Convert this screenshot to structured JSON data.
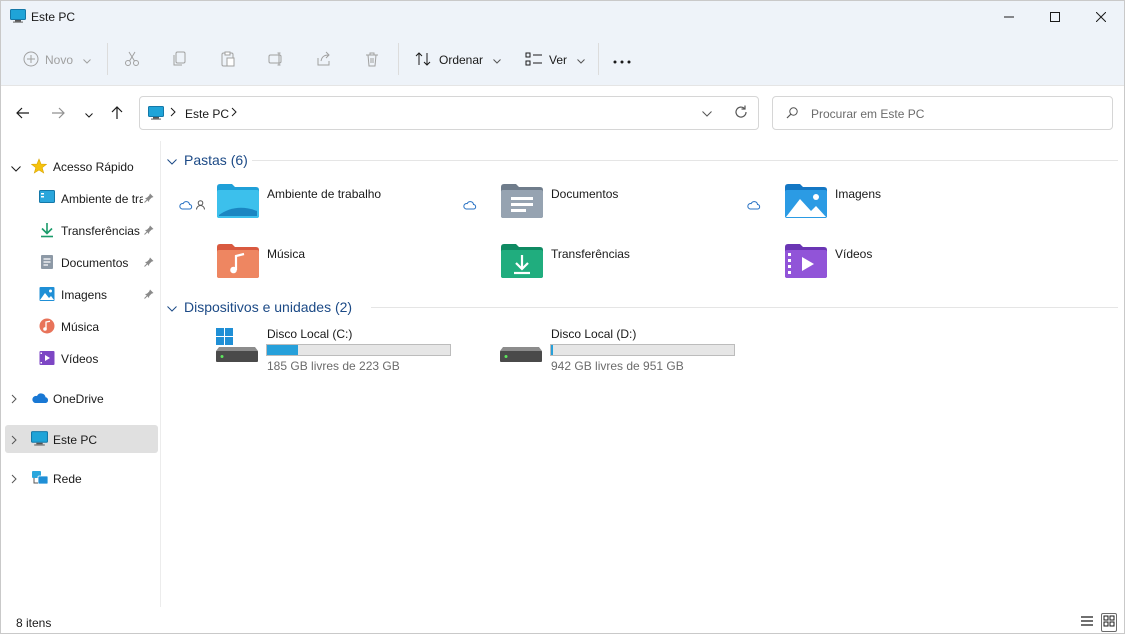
{
  "window": {
    "title": "Este PC"
  },
  "toolbar": {
    "new_label": "Novo",
    "sort_label": "Ordenar",
    "view_label": "Ver"
  },
  "address": {
    "breadcrumb": "Este PC",
    "search_placeholder": "Procurar em Este PC"
  },
  "sidebar": {
    "quick_access": "Acesso Rápido",
    "items": [
      {
        "label": "Ambiente de trabalho",
        "icon": "desktop-icon"
      },
      {
        "label": "Transferências",
        "icon": "downloads-icon"
      },
      {
        "label": "Documentos",
        "icon": "documents-icon"
      },
      {
        "label": "Imagens",
        "icon": "pictures-icon"
      },
      {
        "label": "Música",
        "icon": "music-icon"
      },
      {
        "label": "Vídeos",
        "icon": "videos-icon"
      }
    ],
    "onedrive": "OneDrive",
    "this_pc": "Este PC",
    "network": "Rede"
  },
  "folders": {
    "header": "Pastas (6)",
    "items": [
      {
        "name": "Ambiente de trabalho"
      },
      {
        "name": "Documentos"
      },
      {
        "name": "Imagens"
      },
      {
        "name": "Música"
      },
      {
        "name": "Transferências"
      },
      {
        "name": "Vídeos"
      }
    ]
  },
  "devices": {
    "header": "Dispositivos e unidades (2)",
    "items": [
      {
        "name": "Disco Local (C:)",
        "free_text": "185 GB livres de 223 GB",
        "used_fraction": 0.17
      },
      {
        "name": "Disco Local (D:)",
        "free_text": "942 GB livres de 951 GB",
        "used_fraction": 0.01
      }
    ]
  },
  "status": {
    "count": "8 itens"
  },
  "colors": {
    "accent": "#0067c0",
    "group_header": "#1c4a86",
    "drive_fill": "#26a0da"
  }
}
